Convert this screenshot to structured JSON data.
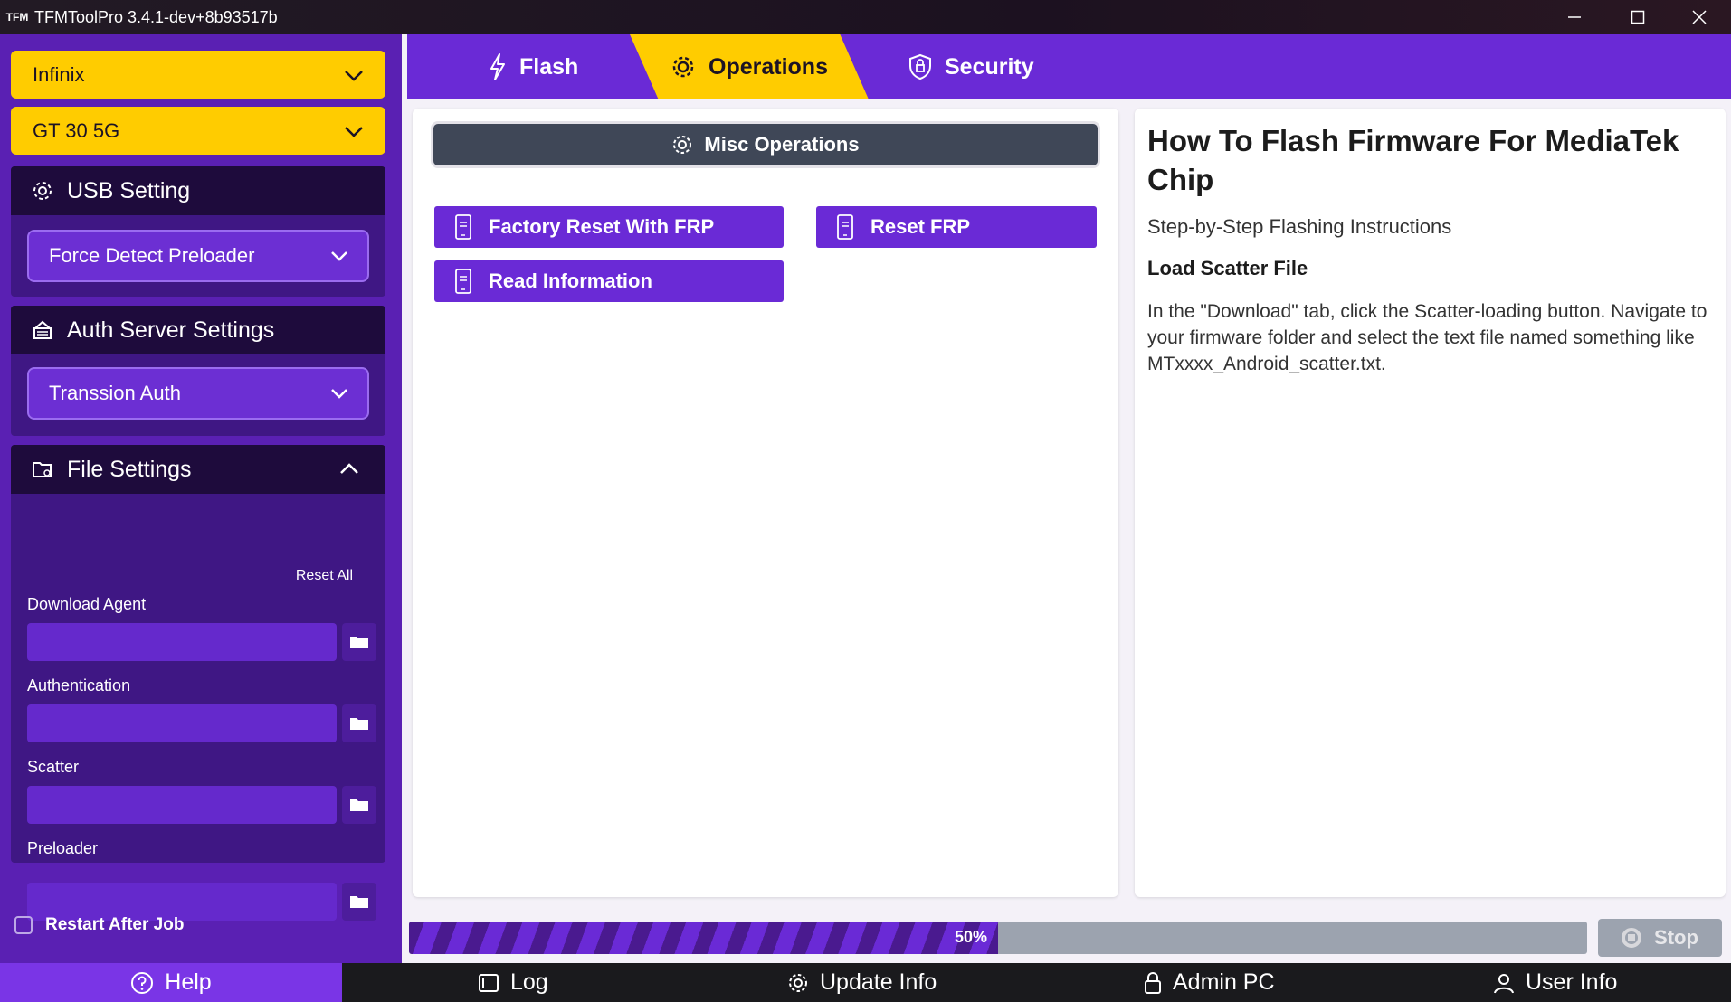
{
  "window": {
    "title": "TFMToolPro 3.4.1-dev+8b93517b",
    "app_icon": "TFM"
  },
  "sidebar": {
    "brand_select": "Infinix",
    "model_select": "GT 30 5G",
    "usb": {
      "title": "USB Setting",
      "mode": "Force Detect Preloader"
    },
    "auth": {
      "title": "Auth Server Settings",
      "server": "Transsion Auth"
    },
    "files": {
      "title": "File Settings",
      "reset_all": "Reset All",
      "fields": [
        {
          "label": "Download Agent",
          "value": ""
        },
        {
          "label": "Authentication",
          "value": ""
        },
        {
          "label": "Scatter",
          "value": ""
        },
        {
          "label": "Preloader",
          "value": ""
        }
      ]
    },
    "restart_after_job": {
      "label": "Restart After Job",
      "checked": false
    }
  },
  "tabs": [
    {
      "label": "Flash",
      "icon": "lightning-icon",
      "active": false
    },
    {
      "label": "Operations",
      "icon": "gear-icon",
      "active": true
    },
    {
      "label": "Security",
      "icon": "shield-lock-icon",
      "active": false
    }
  ],
  "operations": {
    "section_title": "Misc Operations",
    "buttons": [
      "Factory Reset With FRP",
      "Reset FRP",
      "Read Information"
    ]
  },
  "guide": {
    "title": "How To Flash Firmware For MediaTek Chip",
    "subtitle": "Step-by-Step Flashing Instructions",
    "heading": "Load Scatter File",
    "body": "In the \"Download\" tab, click the Scatter-loading button. Navigate to your firmware folder and select the text file named something like MTxxxx_Android_scatter.txt."
  },
  "progress": {
    "value": 0.5,
    "label": "50%"
  },
  "stop_label": "Stop",
  "bottom_nav": [
    "Help",
    "Log",
    "Update Info",
    "Admin PC",
    "User Info"
  ],
  "colors": {
    "purple": "#6a2ad6",
    "yellow": "#ffcc00",
    "dark": "#1e0b3c"
  }
}
